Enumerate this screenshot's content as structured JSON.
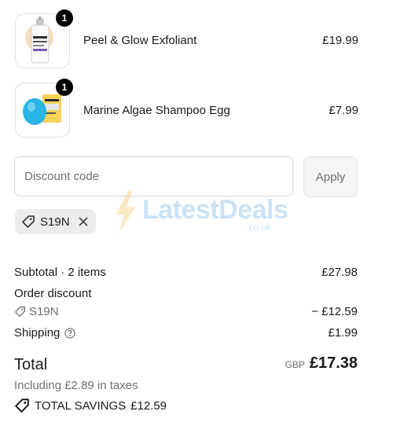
{
  "items": [
    {
      "name": "Peel & Glow Exfoliant",
      "price": "£19.99",
      "quantity": "1",
      "thumb_icon": "serum-bottle-icon"
    },
    {
      "name": "Marine Algae Shampoo Egg",
      "price": "£7.99",
      "quantity": "1",
      "thumb_icon": "shampoo-egg-icon"
    }
  ],
  "discount": {
    "placeholder": "Discount code",
    "value": "",
    "apply_label": "Apply",
    "applied_code": "S19N"
  },
  "watermark": {
    "text": "LatestDeals",
    "sub": ".co.uk"
  },
  "summary": {
    "subtotal_label": "Subtotal · 2 items",
    "subtotal_value": "£27.98",
    "order_discount_label": "Order discount",
    "discount_code": "S19N",
    "discount_value": "− £12.59",
    "shipping_label": "Shipping",
    "shipping_value": "£1.99",
    "total_label": "Total",
    "currency": "GBP",
    "total_value": "£17.38",
    "taxes_text": "Including £2.89 in taxes",
    "savings_label": "TOTAL SAVINGS",
    "savings_value": "£12.59"
  },
  "colors": {
    "badge": "#000000",
    "chip_bg": "#ececec",
    "button_bg": "#f5f5f5",
    "watermark": "#4a9ad8",
    "watermark_bolt": "#f2b43a"
  }
}
